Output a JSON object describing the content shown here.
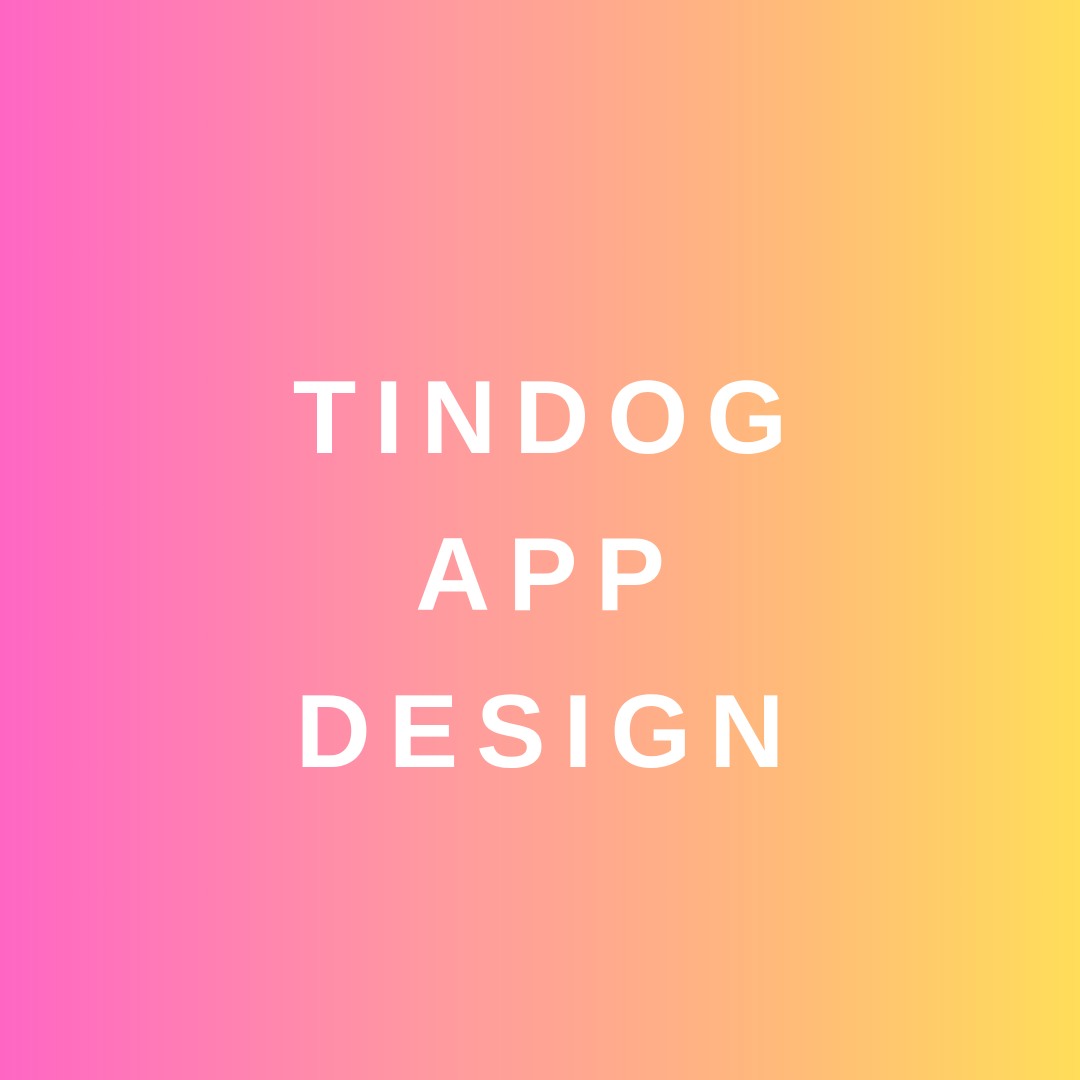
{
  "colors": {
    "background_left": "#ff66c4",
    "background_right": "#ffde59",
    "text": "#ffffff"
  },
  "title": {
    "lines": [
      "TINDOG",
      "APP",
      "DESIGN"
    ]
  }
}
